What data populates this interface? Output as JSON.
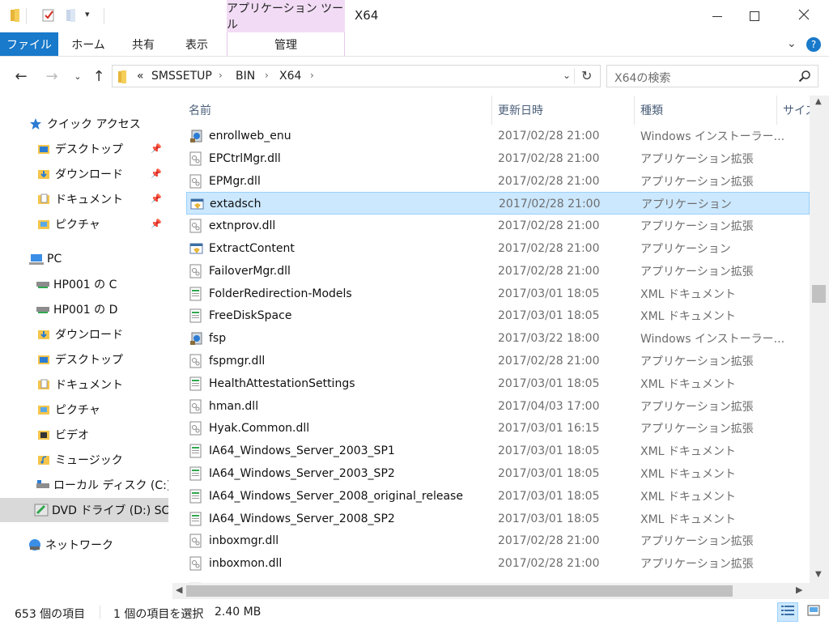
{
  "title_bar": {
    "context_tab_group": "アプリケーション ツール",
    "window_title": "X64"
  },
  "ribbon": {
    "file": "ファイル",
    "home": "ホーム",
    "share": "共有",
    "view": "表示",
    "manage": "管理"
  },
  "address": {
    "overflow": "«",
    "crumbs": [
      "SMSSETUP",
      "BIN",
      "X64"
    ],
    "search_placeholder": "X64の検索"
  },
  "nav": {
    "items": [
      {
        "label": "クイック アクセス",
        "icon": "star-icon"
      },
      {
        "label": "デスクトップ",
        "icon": "folder-icon"
      },
      {
        "label": "ダウンロード",
        "icon": "download-folder-icon"
      },
      {
        "label": "ドキュメント",
        "icon": "documents-folder-icon"
      },
      {
        "label": "ピクチャ",
        "icon": "pictures-folder-icon"
      },
      {
        "label": "PC",
        "icon": "pc-icon"
      },
      {
        "label": "HP001 の C",
        "icon": "network-drive-icon"
      },
      {
        "label": "HP001 の D",
        "icon": "network-drive-icon"
      },
      {
        "label": "ダウンロード",
        "icon": "download-folder-icon"
      },
      {
        "label": "デスクトップ",
        "icon": "folder-icon"
      },
      {
        "label": "ドキュメント",
        "icon": "documents-folder-icon"
      },
      {
        "label": "ピクチャ",
        "icon": "pictures-folder-icon"
      },
      {
        "label": "ビデオ",
        "icon": "video-folder-icon"
      },
      {
        "label": "ミュージック",
        "icon": "music-folder-icon"
      },
      {
        "label": "ローカル ディスク (C:)",
        "icon": "local-disk-icon"
      },
      {
        "label": "DVD ドライブ (D:) SC_",
        "icon": "dvd-drive-icon"
      },
      {
        "label": "ネットワーク",
        "icon": "network-icon"
      }
    ]
  },
  "columns": {
    "name": "名前",
    "date": "更新日時",
    "type": "種類",
    "size": "サイズ"
  },
  "files": [
    {
      "name": "enrollweb_enu",
      "date": "2017/02/28 21:00",
      "type": "Windows インストーラー...",
      "icon": "installer-icon"
    },
    {
      "name": "EPCtrlMgr.dll",
      "date": "2017/02/28 21:00",
      "type": "アプリケーション拡張",
      "icon": "dll-icon"
    },
    {
      "name": "EPMgr.dll",
      "date": "2017/02/28 21:00",
      "type": "アプリケーション拡張",
      "icon": "dll-icon"
    },
    {
      "name": "extadsch",
      "date": "2017/02/28 21:00",
      "type": "アプリケーション",
      "icon": "exe-icon",
      "selected": true
    },
    {
      "name": "extnprov.dll",
      "date": "2017/02/28 21:00",
      "type": "アプリケーション拡張",
      "icon": "dll-icon"
    },
    {
      "name": "ExtractContent",
      "date": "2017/02/28 21:00",
      "type": "アプリケーション",
      "icon": "exe-icon"
    },
    {
      "name": "FailoverMgr.dll",
      "date": "2017/02/28 21:00",
      "type": "アプリケーション拡張",
      "icon": "dll-icon"
    },
    {
      "name": "FolderRedirection-Models",
      "date": "2017/03/01 18:05",
      "type": "XML ドキュメント",
      "icon": "xml-icon"
    },
    {
      "name": "FreeDiskSpace",
      "date": "2017/03/01 18:05",
      "type": "XML ドキュメント",
      "icon": "xml-icon"
    },
    {
      "name": "fsp",
      "date": "2017/03/22 18:00",
      "type": "Windows インストーラー...",
      "icon": "installer-icon"
    },
    {
      "name": "fspmgr.dll",
      "date": "2017/02/28 21:00",
      "type": "アプリケーション拡張",
      "icon": "dll-icon"
    },
    {
      "name": "HealthAttestationSettings",
      "date": "2017/03/01 18:05",
      "type": "XML ドキュメント",
      "icon": "xml-icon"
    },
    {
      "name": "hman.dll",
      "date": "2017/04/03 17:00",
      "type": "アプリケーション拡張",
      "icon": "dll-icon"
    },
    {
      "name": "Hyak.Common.dll",
      "date": "2017/03/01 16:15",
      "type": "アプリケーション拡張",
      "icon": "dll-icon"
    },
    {
      "name": "IA64_Windows_Server_2003_SP1",
      "date": "2017/03/01 18:05",
      "type": "XML ドキュメント",
      "icon": "xml-icon"
    },
    {
      "name": "IA64_Windows_Server_2003_SP2",
      "date": "2017/03/01 18:05",
      "type": "XML ドキュメント",
      "icon": "xml-icon"
    },
    {
      "name": "IA64_Windows_Server_2008_original_release",
      "date": "2017/03/01 18:05",
      "type": "XML ドキュメント",
      "icon": "xml-icon"
    },
    {
      "name": "IA64_Windows_Server_2008_SP2",
      "date": "2017/03/01 18:05",
      "type": "XML ドキュメント",
      "icon": "xml-icon"
    },
    {
      "name": "inboxmgr.dll",
      "date": "2017/02/28 21:00",
      "type": "アプリケーション拡張",
      "icon": "dll-icon"
    },
    {
      "name": "inboxmon.dll",
      "date": "2017/02/28 21:00",
      "type": "アプリケーション拡張",
      "icon": "dll-icon"
    }
  ],
  "status": {
    "item_count": "653 個の項目",
    "selection": "1 個の項目を選択",
    "size": "2.40 MB"
  },
  "colors": {
    "file_tab": "#1979ca",
    "context_tab": "#f2dcf5",
    "selection": "#cce8ff",
    "selection_border": "#99d1ff"
  }
}
